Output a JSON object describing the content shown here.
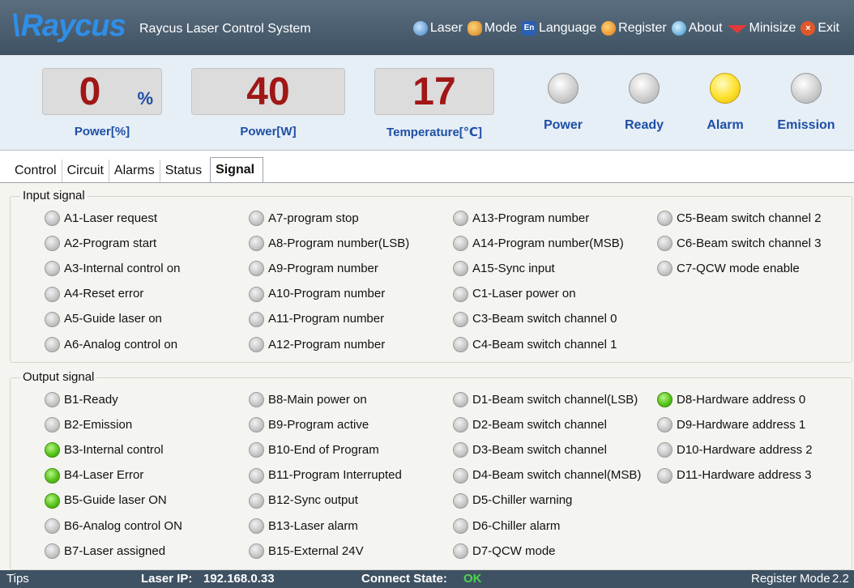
{
  "titlebar": {
    "logo_text": "Raycus",
    "app_title": "Raycus Laser Control System",
    "menu": [
      {
        "label": "Laser",
        "icon": "laser-globe-icon"
      },
      {
        "label": "Mode",
        "icon": "mode-people-icon"
      },
      {
        "label": "Language",
        "icon": "language-en-icon",
        "icon_text": "En"
      },
      {
        "label": "Register",
        "icon": "register-key-icon"
      },
      {
        "label": "About",
        "icon": "about-info-icon"
      },
      {
        "label": "Minisize",
        "icon": "minimize-arrow-icon"
      },
      {
        "label": "Exit",
        "icon": "exit-x-icon",
        "icon_text": "×"
      }
    ]
  },
  "gauges": {
    "power_percent": {
      "value": "0",
      "unit": "%",
      "label": "Power[%]"
    },
    "power_watts": {
      "value": "40",
      "label": "Power[W]"
    },
    "temperature": {
      "value": "17",
      "label": "Temperature[℃]"
    }
  },
  "indicators": [
    {
      "label": "Power",
      "state": "off"
    },
    {
      "label": "Ready",
      "state": "off"
    },
    {
      "label": "Alarm",
      "state": "yellow"
    },
    {
      "label": "Emission",
      "state": "off"
    }
  ],
  "tabs": [
    "Control",
    "Circuit",
    "Alarms",
    "Status",
    "Signal"
  ],
  "active_tab": "Signal",
  "input_signal": {
    "title": "Input signal",
    "columns": [
      [
        {
          "label": "A1-Laser request",
          "on": false
        },
        {
          "label": "A2-Program start",
          "on": false
        },
        {
          "label": "A3-Internal control on",
          "on": false
        },
        {
          "label": "A4-Reset error",
          "on": false
        },
        {
          "label": "A5-Guide laser on",
          "on": false
        },
        {
          "label": "A6-Analog control on",
          "on": false
        }
      ],
      [
        {
          "label": "A7-program stop",
          "on": false
        },
        {
          "label": "A8-Program number(LSB)",
          "on": false
        },
        {
          "label": "A9-Program number",
          "on": false
        },
        {
          "label": "A10-Program number",
          "on": false
        },
        {
          "label": "A11-Program number",
          "on": false
        },
        {
          "label": "A12-Program number",
          "on": false
        }
      ],
      [
        {
          "label": "A13-Program number",
          "on": false
        },
        {
          "label": "A14-Program number(MSB)",
          "on": false
        },
        {
          "label": "A15-Sync input",
          "on": false
        },
        {
          "label": "C1-Laser power on",
          "on": false
        },
        {
          "label": "C3-Beam switch channel 0",
          "on": false
        },
        {
          "label": "C4-Beam switch channel 1",
          "on": false
        }
      ],
      [
        {
          "label": "C5-Beam switch channel 2",
          "on": false
        },
        {
          "label": "C6-Beam switch channel 3",
          "on": false
        },
        {
          "label": "C7-QCW mode enable",
          "on": false
        }
      ]
    ]
  },
  "output_signal": {
    "title": "Output signal",
    "columns": [
      [
        {
          "label": "B1-Ready",
          "on": false
        },
        {
          "label": "B2-Emission",
          "on": false
        },
        {
          "label": "B3-Internal control",
          "on": true
        },
        {
          "label": "B4-Laser Error",
          "on": true
        },
        {
          "label": "B5-Guide laser ON",
          "on": true
        },
        {
          "label": "B6-Analog control ON",
          "on": false
        },
        {
          "label": "B7-Laser assigned",
          "on": false
        }
      ],
      [
        {
          "label": "B8-Main power on",
          "on": false
        },
        {
          "label": "B9-Program active",
          "on": false
        },
        {
          "label": "B10-End of Program",
          "on": false
        },
        {
          "label": "B11-Program Interrupted",
          "on": false
        },
        {
          "label": "B12-Sync output",
          "on": false
        },
        {
          "label": "B13-Laser alarm",
          "on": false
        },
        {
          "label": "B15-External 24V",
          "on": false
        }
      ],
      [
        {
          "label": "D1-Beam switch channel(LSB)",
          "on": false
        },
        {
          "label": "D2-Beam switch channel",
          "on": false
        },
        {
          "label": "D3-Beam switch channel",
          "on": false
        },
        {
          "label": "D4-Beam switch channel(MSB)",
          "on": false
        },
        {
          "label": "D5-Chiller warning",
          "on": false
        },
        {
          "label": "D6-Chiller alarm",
          "on": false
        },
        {
          "label": "D7-QCW mode",
          "on": false
        }
      ],
      [
        {
          "label": "D8-Hardware address 0",
          "on": true
        },
        {
          "label": "D9-Hardware address 1",
          "on": false
        },
        {
          "label": "D10-Hardware address 2",
          "on": false
        },
        {
          "label": "D11-Hardware address 3",
          "on": false
        }
      ]
    ]
  },
  "statusbar": {
    "tips": "Tips",
    "ip_label": "Laser IP:",
    "ip_value": "192.168.0.33",
    "connect_label": "Connect State:",
    "connect_value": "OK",
    "mode": "Register Mode",
    "version": "2.2"
  },
  "colors": {
    "gauge_value": "#a11616",
    "label_blue": "#1d4fa6",
    "led_green": "#58c41b",
    "led_yellow": "#fde02a",
    "titlebar_bg": "#4a5d6e"
  }
}
